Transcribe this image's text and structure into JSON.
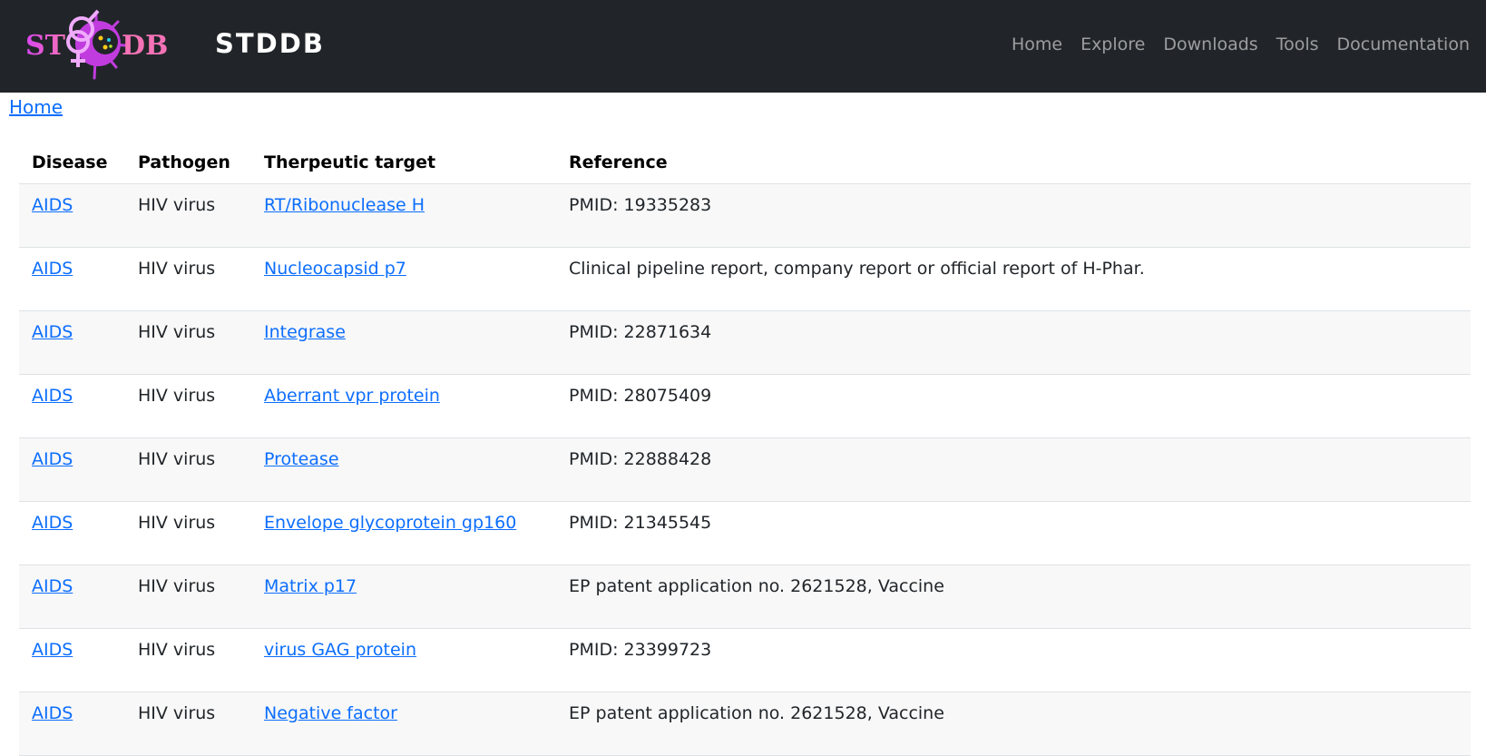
{
  "header": {
    "brand": "STDDB",
    "logo_text_left": "ST",
    "logo_text_right": "DB",
    "nav": [
      {
        "label": "Home"
      },
      {
        "label": "Explore"
      },
      {
        "label": "Downloads"
      },
      {
        "label": "Tools"
      },
      {
        "label": "Documentation"
      }
    ]
  },
  "breadcrumb": {
    "home": "Home"
  },
  "table": {
    "headers": [
      "Disease",
      "Pathogen",
      "Therpeutic target",
      "Reference"
    ],
    "rows": [
      {
        "disease": "AIDS",
        "pathogen": "HIV virus",
        "target": "RT/Ribonuclease H",
        "reference": "PMID: 19335283"
      },
      {
        "disease": "AIDS",
        "pathogen": "HIV virus",
        "target": "Nucleocapsid p7",
        "reference": "Clinical pipeline report, company report or official report of H-Phar."
      },
      {
        "disease": "AIDS",
        "pathogen": "HIV virus",
        "target": "Integrase",
        "reference": "PMID: 22871634"
      },
      {
        "disease": "AIDS",
        "pathogen": "HIV virus",
        "target": "Aberrant vpr protein",
        "reference": "PMID: 28075409"
      },
      {
        "disease": "AIDS",
        "pathogen": "HIV virus",
        "target": "Protease",
        "reference": "PMID: 22888428"
      },
      {
        "disease": "AIDS",
        "pathogen": "HIV virus",
        "target": "Envelope glycoprotein gp160",
        "reference": "PMID: 21345545"
      },
      {
        "disease": "AIDS",
        "pathogen": "HIV virus",
        "target": "Matrix p17",
        "reference": "EP patent application no. 2621528, Vaccine"
      },
      {
        "disease": "AIDS",
        "pathogen": "HIV virus",
        "target": "virus GAG protein",
        "reference": "PMID: 23399723"
      },
      {
        "disease": "AIDS",
        "pathogen": "HIV virus",
        "target": "Negative factor",
        "reference": "EP patent application no. 2621528, Vaccine"
      }
    ]
  }
}
